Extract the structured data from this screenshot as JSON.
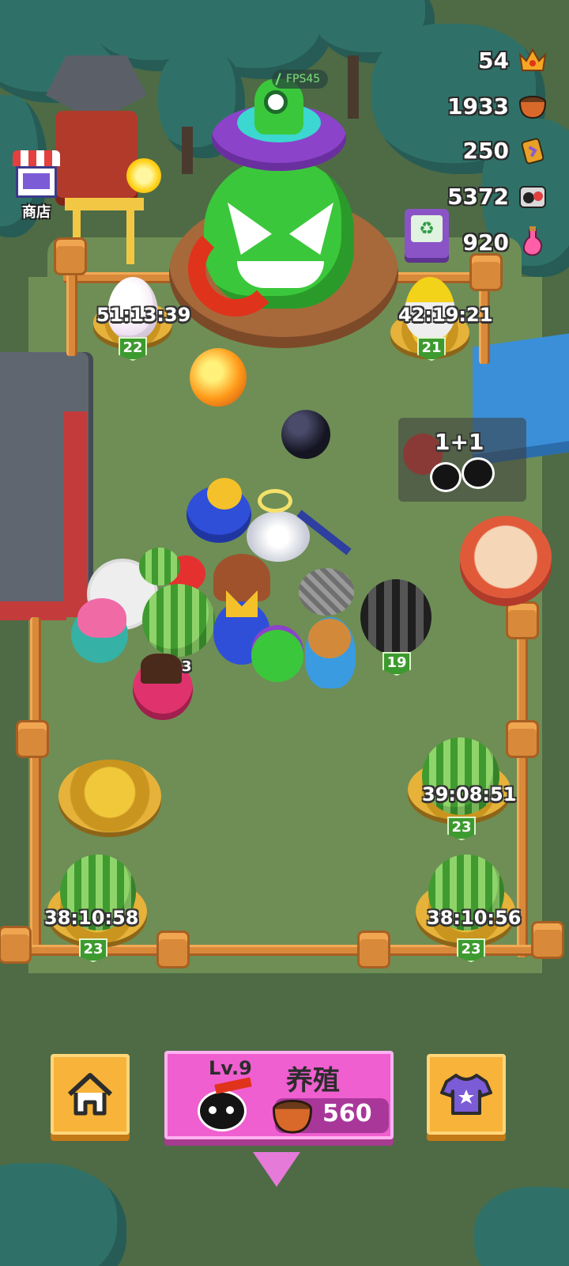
{
  "hud": {
    "resources": [
      {
        "value": "54",
        "icon": "crown-icon",
        "color": "#f5a623"
      },
      {
        "value": "1933",
        "icon": "food-bowl-icon",
        "color": "#c0622a"
      },
      {
        "value": "250",
        "icon": "potion-can-icon",
        "color": "#8a5cd0"
      },
      {
        "value": "5372",
        "icon": "bomb-pair-icon",
        "color": "#e04040"
      },
      {
        "value": "920",
        "icon": "love-potion-icon",
        "color": "#ff5fa8"
      }
    ],
    "fps": "FPS45",
    "shop_label": "商店"
  },
  "nests": [
    {
      "timer": "51:13:39",
      "level": "22"
    },
    {
      "timer": "42:19:21",
      "level": "21"
    },
    {
      "timer": "39:08:51",
      "level": "23"
    },
    {
      "timer": "38:10:58",
      "level": "23"
    },
    {
      "timer": "38:10:56",
      "level": "23"
    }
  ],
  "pets": {
    "striped_ball_level": "19",
    "watermelon_partial_level": "3"
  },
  "merge_hint": "1+1",
  "bottom_bar": {
    "breed_level": "Lv.9",
    "breed_title": "养殖",
    "breed_cost": "560"
  },
  "colors": {
    "home_button": "#f7b33a",
    "breed_button": "#ef5fd0",
    "field": "#6e8e55"
  }
}
